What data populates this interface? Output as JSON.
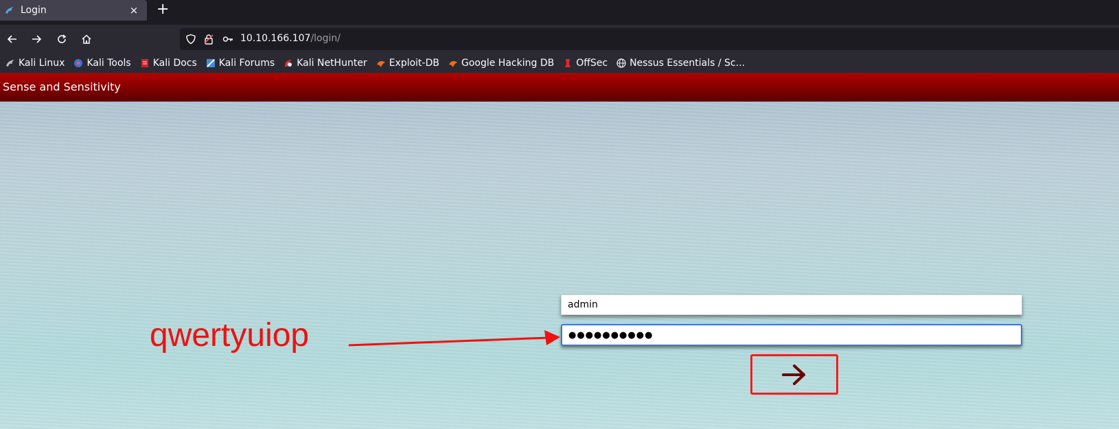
{
  "browser": {
    "tab": {
      "title": "Login",
      "close": "×"
    },
    "new_tab": "+",
    "url": {
      "host": "10.10.166.107",
      "path": "/login/"
    },
    "bookmarks": [
      {
        "label": "Kali Linux",
        "icon": "kali-dragon-icon"
      },
      {
        "label": "Kali Tools",
        "icon": "kali-tools-icon"
      },
      {
        "label": "Kali Docs",
        "icon": "kali-docs-icon"
      },
      {
        "label": "Kali Forums",
        "icon": "kali-forums-icon"
      },
      {
        "label": "Kali NetHunter",
        "icon": "nethunter-icon"
      },
      {
        "label": "Exploit-DB",
        "icon": "exploit-db-icon"
      },
      {
        "label": "Google Hacking DB",
        "icon": "ghdb-icon"
      },
      {
        "label": "OffSec",
        "icon": "offsec-icon"
      },
      {
        "label": "Nessus Essentials / Sc...",
        "icon": "globe-icon"
      }
    ]
  },
  "site": {
    "title": "Sense and Sensitivity",
    "header_color": "#8a0000"
  },
  "login": {
    "username_value": "admin",
    "password_masked": "●●●●●●●●●●",
    "submit_icon": "arrow-right-icon",
    "submit_icon_color": "#6b0000"
  },
  "annotation": {
    "text": "qwertyuiop",
    "color": "#f01010"
  }
}
